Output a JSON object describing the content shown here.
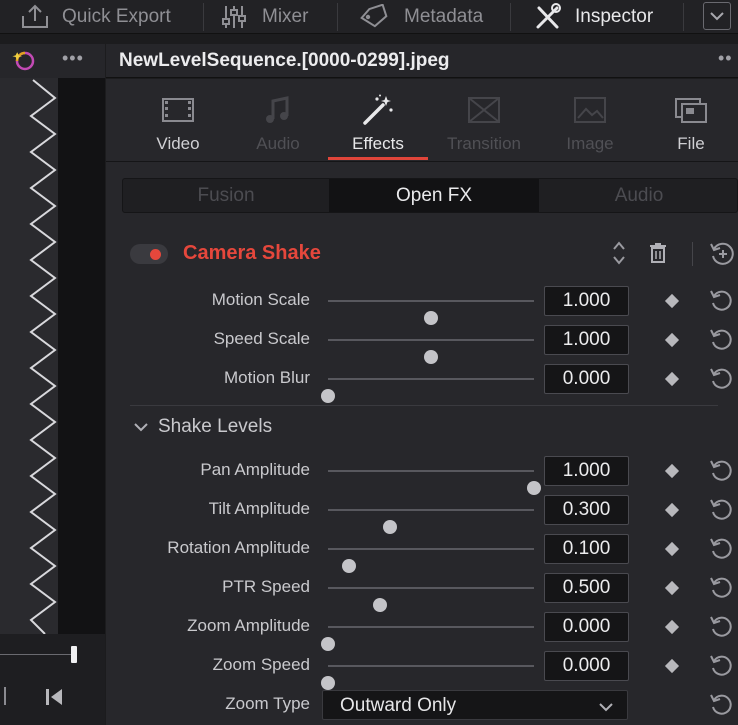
{
  "toolbar": {
    "items": [
      {
        "label": "Quick Export",
        "icon": "export-icon"
      },
      {
        "label": "Mixer",
        "icon": "mixer-icon"
      },
      {
        "label": "Metadata",
        "icon": "metadata-icon"
      },
      {
        "label": "Inspector",
        "icon": "inspector-icon"
      }
    ],
    "active": "Inspector"
  },
  "clip": {
    "name": "NewLevelSequence.[0000-0299].jpeg"
  },
  "tabs": [
    {
      "label": "Video",
      "icon": "video-film-icon",
      "state": "available"
    },
    {
      "label": "Audio",
      "icon": "audio-note-icon",
      "state": "disabled"
    },
    {
      "label": "Effects",
      "icon": "effects-wand-icon",
      "state": "active"
    },
    {
      "label": "Transition",
      "icon": "transition-icon",
      "state": "disabled"
    },
    {
      "label": "Image",
      "icon": "image-icon",
      "state": "disabled"
    },
    {
      "label": "File",
      "icon": "file-icon",
      "state": "available"
    }
  ],
  "subtabs": [
    {
      "label": "Fusion",
      "state": "disabled"
    },
    {
      "label": "Open FX",
      "state": "active"
    },
    {
      "label": "Audio",
      "state": "disabled"
    }
  ],
  "effect": {
    "title": "Camera Shake",
    "enabled": true,
    "accent": "#e5473c"
  },
  "params": [
    {
      "label": "Motion Scale",
      "value": "1.000",
      "slider": 0.5
    },
    {
      "label": "Speed Scale",
      "value": "1.000",
      "slider": 0.5
    },
    {
      "label": "Motion Blur",
      "value": "0.000",
      "slider": 0.0
    }
  ],
  "group": {
    "label": "Shake Levels",
    "expanded": true
  },
  "group_params": [
    {
      "label": "Pan Amplitude",
      "value": "1.000",
      "slider": 1.0
    },
    {
      "label": "Tilt Amplitude",
      "value": "0.300",
      "slider": 0.3
    },
    {
      "label": "Rotation Amplitude",
      "value": "0.100",
      "slider": 0.1
    },
    {
      "label": "PTR Speed",
      "value": "0.500",
      "slider": 0.25
    },
    {
      "label": "Zoom Amplitude",
      "value": "0.000",
      "slider": 0.0
    },
    {
      "label": "Zoom Speed",
      "value": "0.000",
      "slider": 0.0
    }
  ],
  "zoom_type": {
    "label": "Zoom Type",
    "value": "Outward Only"
  }
}
